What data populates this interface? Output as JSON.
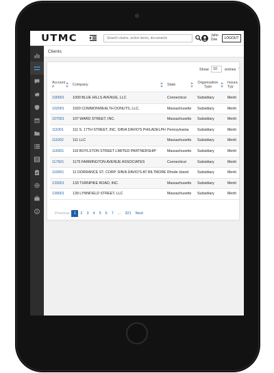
{
  "header": {
    "logo": "UTMC",
    "search_placeholder": "Search claims, action items, documents",
    "user_first": "John",
    "user_last": "Doe",
    "logout": "LOGOUT"
  },
  "sidebar": {
    "items": [
      {
        "icon": "bar-chart-icon"
      },
      {
        "icon": "dashboard-icon",
        "active": true
      },
      {
        "icon": "message-icon"
      },
      {
        "icon": "cloud-icon"
      },
      {
        "icon": "shield-icon"
      },
      {
        "icon": "calendar-icon"
      },
      {
        "icon": "folder-icon"
      },
      {
        "icon": "list-icon"
      },
      {
        "icon": "table-icon"
      },
      {
        "icon": "clipboard-icon"
      },
      {
        "icon": "settings-icon"
      },
      {
        "icon": "briefcase-icon"
      },
      {
        "icon": "info-icon"
      }
    ]
  },
  "page": {
    "title": "Clients"
  },
  "controls": {
    "show_label": "Show",
    "show_value": "10",
    "entries_label": "entries"
  },
  "table": {
    "headers": {
      "account": "Account #",
      "company": "Company",
      "state": "State",
      "org_type": "Organization Type",
      "insurance": "Insura Typ"
    },
    "rows": [
      {
        "account": "100001",
        "company": "1000 BLUE HILLS AVENUE, LLC",
        "state": "Connecticut",
        "org_type": "Subsidiary",
        "insurance": "Meriti"
      },
      {
        "account": "102001",
        "company": "1020 COMMONWEALTH DONUTS, LLC.",
        "state": "Massachusetts",
        "org_type": "Subsidiary",
        "insurance": "Meriti"
      },
      {
        "account": "107001",
        "company": "107 WARD STREET, INC.",
        "state": "Massachusetts",
        "org_type": "Subsidiary",
        "insurance": "Meriti"
      },
      {
        "account": "111001",
        "company": "111 S. 17TH STREET, INC. D/B/A DAVIO'S PHILADELPHIA",
        "state": "Pennsylvania",
        "org_type": "Subsidiary",
        "insurance": "Meriti"
      },
      {
        "account": "111002",
        "company": "111 LLC",
        "state": "Massachusetts",
        "org_type": "Subsidiary",
        "insurance": "Meriti"
      },
      {
        "account": "116001",
        "company": "116 BOYLSTON STREET LIMITED PARTNERSHIP",
        "state": "Massachusetts",
        "org_type": "Subsidiary",
        "insurance": "Meriti"
      },
      {
        "account": "117501",
        "company": "1175 FARMINGTON AVENUE ASSOCIATES",
        "state": "Connecticut",
        "org_type": "Subsidiary",
        "insurance": "Meriti"
      },
      {
        "account": "110001",
        "company": "11 DORRANCE ST. CORP. D/B/A DAVIO'S AT BILTMORE",
        "state": "Rhode Island",
        "org_type": "Subsidiary",
        "insurance": "Meriti"
      },
      {
        "account": "133001",
        "company": "133 TURNPIKE ROAD, INC.",
        "state": "Massachusetts",
        "org_type": "Subsidiary",
        "insurance": "Meriti"
      },
      {
        "account": "139001",
        "company": "139 LYNNFIELD STREET, LLC",
        "state": "Massachusetts",
        "org_type": "Subsidiary",
        "insurance": "Meriti"
      }
    ]
  },
  "pagination": {
    "previous": "Previous",
    "pages": [
      "1",
      "2",
      "3",
      "4",
      "5",
      "6",
      "7",
      "...",
      "321"
    ],
    "current": "1",
    "next": "Next"
  },
  "colors": {
    "link": "#1f5fa8",
    "sidebar": "#2d2d2d",
    "active_page": "#1f5fa8"
  }
}
